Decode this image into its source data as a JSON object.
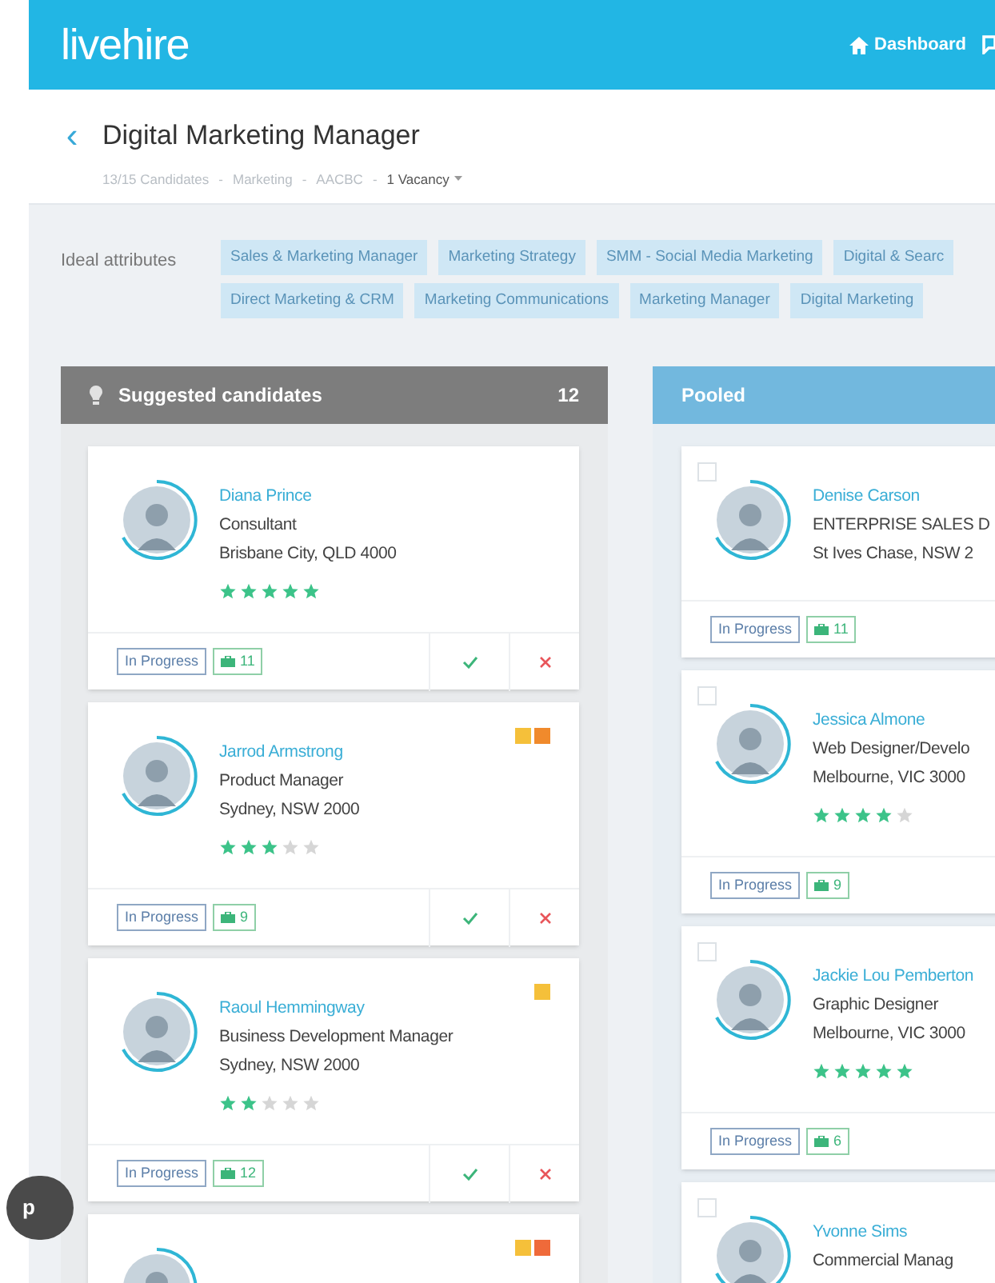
{
  "header": {
    "logo": {
      "light": "live",
      "bold": "hire"
    },
    "nav": [
      {
        "label": "Dashboard",
        "kind": "home"
      },
      {
        "kind": "chat"
      }
    ]
  },
  "job": {
    "back": "‹",
    "title": "Digital Marketing Manager",
    "breadcrumbs": [
      {
        "label": "13/15 Candidates",
        "dropdown": false
      },
      {
        "label": "Marketing",
        "dropdown": false
      },
      {
        "label": "AACBC",
        "dropdown": false
      },
      {
        "label": "1 Vacancy",
        "dropdown": true
      }
    ],
    "separator": "-"
  },
  "ideal_attributes": {
    "label": "Ideal attributes",
    "tags": [
      [
        "Sales & Marketing Manager",
        "Marketing Strategy",
        "SMM - Social Media Marketing",
        "Digital & Searc"
      ],
      [
        "Direct Marketing & CRM",
        "Marketing Communications",
        "Marketing Manager",
        "Digital Marketing"
      ]
    ]
  },
  "columns": [
    {
      "kind": "suggested",
      "title": "Suggested candidates",
      "count": "12",
      "cards": [
        {
          "name": "Diana Prince",
          "role": "Consultant",
          "location": "Brisbane City, QLD 4000",
          "stars": 5,
          "status": "In Progress",
          "count": "11"
        },
        {
          "name": "Jarrod Armstrong",
          "role": "Product Manager",
          "location": "Sydney, NSW 2000",
          "stars": 3,
          "status": "In Progress",
          "count": "9",
          "badges": [
            {
              "color": "#f5c03a"
            },
            {
              "color": "#f08a2c"
            }
          ]
        },
        {
          "name": "Raoul Hemmingway",
          "role": "Business Development Manager",
          "location": "Sydney, NSW 2000",
          "stars": 2,
          "status": "In Progress",
          "count": "12",
          "badges": [
            {
              "color": "#f5c03a"
            }
          ]
        },
        {
          "badges": [
            {
              "color": "#f5c03a"
            },
            {
              "color": "#ef6a3a"
            }
          ]
        }
      ]
    },
    {
      "kind": "pooled",
      "title": "Pooled",
      "cards": [
        {
          "checked": false,
          "name": "Denise Carson",
          "role": "ENTERPRISE SALES D",
          "location": "St Ives Chase, NSW 2",
          "status": "In Progress",
          "count": "11"
        },
        {
          "checked": false,
          "name": "Jessica Almone",
          "role": "Web Designer/Develo",
          "location": "Melbourne, VIC 3000",
          "stars": 4,
          "status": "In Progress",
          "count": "9"
        },
        {
          "checked": false,
          "name": "Jackie Lou Pemberton",
          "role": "Graphic Designer",
          "location": "Melbourne, VIC 3000",
          "stars": 5,
          "status": "In Progress",
          "count": "6"
        },
        {
          "checked": false,
          "name": "Yvonne Sims",
          "role": "Commercial Manag"
        }
      ]
    }
  ],
  "help_button": {
    "label": "p"
  }
}
